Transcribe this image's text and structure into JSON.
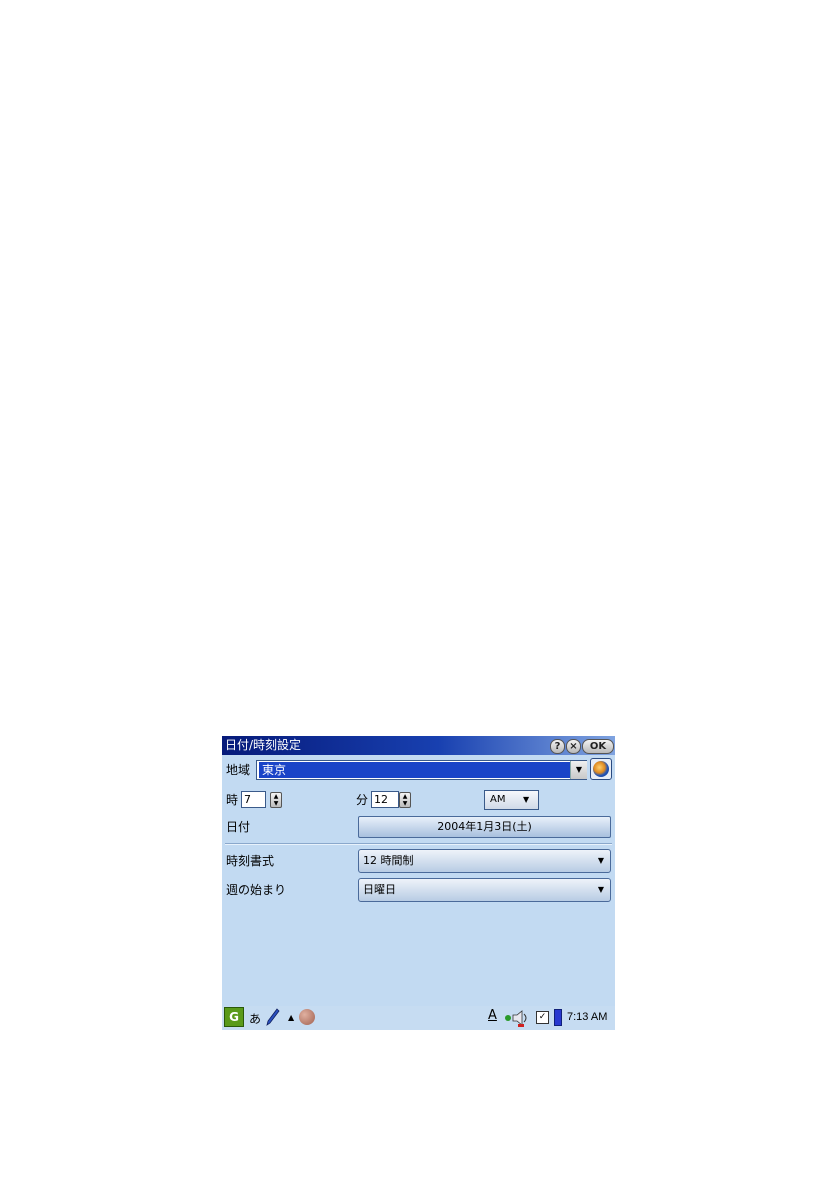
{
  "window": {
    "title": "日付/時刻設定",
    "help_label": "?",
    "close_label": "×",
    "ok_label": "OK"
  },
  "region": {
    "label": "地域",
    "value": "東京"
  },
  "time": {
    "hour_label": "時",
    "hour_value": "7",
    "minute_label": "分",
    "minute_value": "12",
    "ampm_value": "AM"
  },
  "date": {
    "label": "日付",
    "value": "2004年1月3日(土)"
  },
  "time_format": {
    "label": "時刻書式",
    "value": "12 時間制"
  },
  "week_start": {
    "label": "週の始まり",
    "value": "日曜日"
  },
  "taskbar": {
    "input_mode": "あ",
    "clock": "7:13 AM"
  },
  "colors": {
    "background": "#c2daf2",
    "titlebar": "#1840b0",
    "selection": "#1a44c8"
  }
}
